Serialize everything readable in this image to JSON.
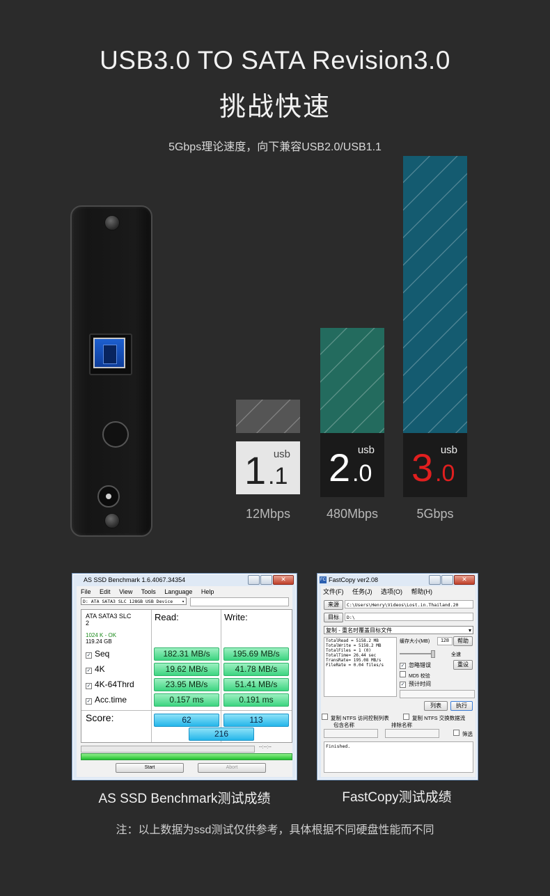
{
  "header": {
    "title": "USB3.0 TO SATA Revision3.0",
    "subtitle": "挑战快速",
    "tagline": "5Gbps理论速度，向下兼容USB2.0/USB1.1"
  },
  "bars": [
    {
      "major": "1",
      "minor": ".1",
      "label": "usb",
      "speed": "12Mbps",
      "relative_height": 0.12,
      "color": "#555555",
      "badge_bg": "#e6e6e6",
      "digit_color": "#222222"
    },
    {
      "major": "2",
      "minor": ".0",
      "label": "usb",
      "speed": "480Mbps",
      "relative_height": 0.38,
      "color": "#236b5e",
      "badge_bg": "#1a1a1a",
      "digit_color": "#ffffff"
    },
    {
      "major": "3",
      "minor": ".0",
      "label": "usb",
      "speed": "5Gbps",
      "relative_height": 1.0,
      "color": "#145b70",
      "badge_bg": "#1a1a1a",
      "digit_color": "#e01f1f"
    }
  ],
  "as_ssd": {
    "window_title": "AS SSD Benchmark 1.6.4067.34354",
    "menu": [
      "File",
      "Edit",
      "View",
      "Tools",
      "Language",
      "Help"
    ],
    "drive_select": "D: ATA SATA3 SLC 128GB USB Device",
    "drive_name": "ATA SATA3 SLC",
    "drive_num": "2",
    "status": "1024 K - OK",
    "capacity": "119.24 GB",
    "read_header": "Read:",
    "write_header": "Write:",
    "rows": [
      {
        "name": "Seq",
        "read": "182.31 MB/s",
        "write": "195.69 MB/s"
      },
      {
        "name": "4K",
        "read": "19.62 MB/s",
        "write": "41.78 MB/s"
      },
      {
        "name": "4K-64Thrd",
        "read": "23.95 MB/s",
        "write": "51.41 MB/s"
      },
      {
        "name": "Acc.time",
        "read": "0.157 ms",
        "write": "0.191 ms"
      }
    ],
    "score_label": "Score:",
    "score_read": "62",
    "score_write": "113",
    "score_total": "216",
    "progress_time": "--:--:--",
    "start_button": "Start",
    "abort_button": "Abort"
  },
  "fastcopy": {
    "window_title": "FastCopy ver2.08",
    "menu": [
      "文件(F)",
      "任务(J)",
      "选项(O)",
      "帮助(H)"
    ],
    "source_button": "来源",
    "source_path": "C:\\Users\\Henry\\Videos\\Lost.in.Thailand.20",
    "dest_button": "目标",
    "dest_path": "D:\\",
    "mode": "复制 - 重名时覆盖目标文件",
    "stats": [
      "TotalRead = 5158.2 MB",
      "TotalWrite = 5158.2 MB",
      "TotalFiles = 1 (0)",
      "TotalTime= 26.44 sec",
      "TransRate= 195.08 MB/s",
      "FileRate  = 0.04 files/s"
    ],
    "buffer_label": "缓存大小(MB)",
    "buffer_value": "128",
    "help_button": "帮助",
    "full_speed": "全速",
    "ignore_errors": "忽略错误",
    "reset_button": "重设",
    "md5_verify": "MD5 校验",
    "estimate_time": "预计时间",
    "list_button": "列表",
    "execute_button": "执行",
    "copy_ntfs_acl": "复制 NTFS 访问控制列表",
    "copy_ntfs_stream": "复制 NTFS 交换数据流",
    "include_label": "包含名称",
    "exclude_label": "排除名称",
    "filter_label": "筛选",
    "log": "Finished."
  },
  "captions": {
    "as_ssd": "AS SSD Benchmark测试成绩",
    "fastcopy": "FastCopy测试成绩"
  },
  "note": "注：以上数据为ssd测试仅供参考，具体根据不同硬盘性能而不同"
}
